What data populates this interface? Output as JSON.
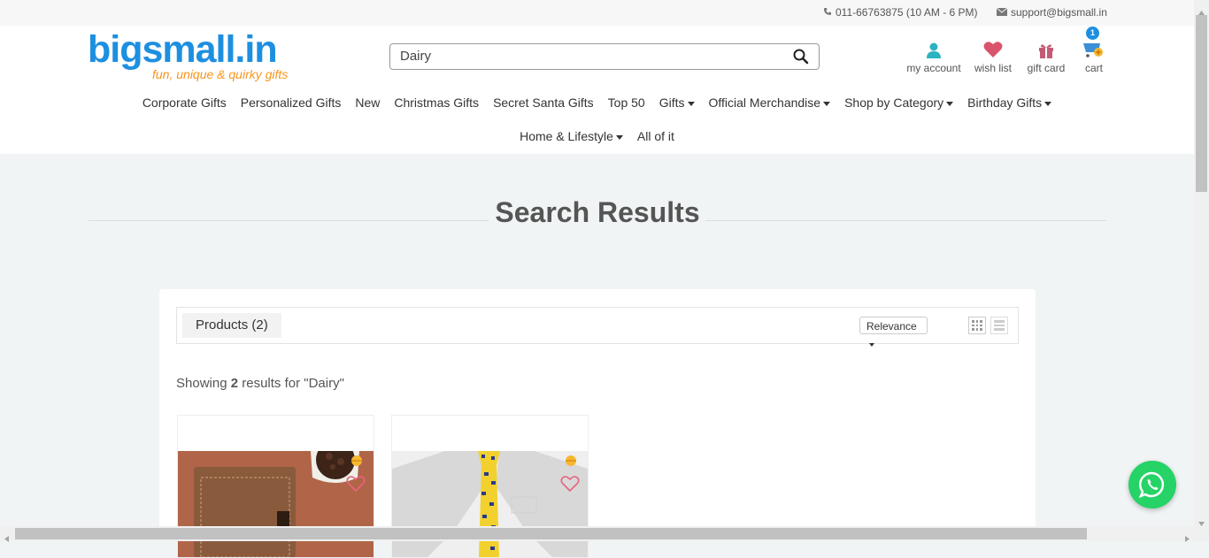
{
  "topbar": {
    "phone": "011-66763875 (10 AM - 6 PM)",
    "email": "support@bigsmall.in"
  },
  "logo": {
    "brand": "bigsmall.in",
    "tagline": "fun, unique & quirky gifts"
  },
  "search": {
    "value": "Dairy",
    "icon": "search-icon"
  },
  "account_links": [
    {
      "label": "my account",
      "icon": "user-icon"
    },
    {
      "label": "wish list",
      "icon": "heart-icon"
    },
    {
      "label": "gift card",
      "icon": "gift-icon"
    },
    {
      "label": "cart",
      "icon": "cart-icon"
    }
  ],
  "cart_count": "1",
  "nav": {
    "row1": [
      {
        "label": "Corporate Gifts"
      },
      {
        "label": "Personalized Gifts"
      },
      {
        "label": "New"
      },
      {
        "label": "Christmas Gifts"
      },
      {
        "label": "Secret Santa Gifts"
      },
      {
        "label": "Top 50"
      },
      {
        "label": "Gifts"
      },
      {
        "label": "Official Merchandise"
      },
      {
        "label": "Shop by Category"
      },
      {
        "label": "Birthday Gifts"
      }
    ],
    "row2": [
      {
        "label": "Home & Lifestyle"
      },
      {
        "label": "All of it"
      }
    ]
  },
  "page_title": "Search Results",
  "results": {
    "tab_label": "Products (2)",
    "sort_value": "Relevance",
    "showing_prefix": "Showing ",
    "count": "2",
    "showing_suffix": " results for \"Dairy\""
  },
  "colors": {
    "brand_blue": "#1d8fe1",
    "brand_orange": "#f7941d",
    "whatsapp_green": "#25d366"
  }
}
